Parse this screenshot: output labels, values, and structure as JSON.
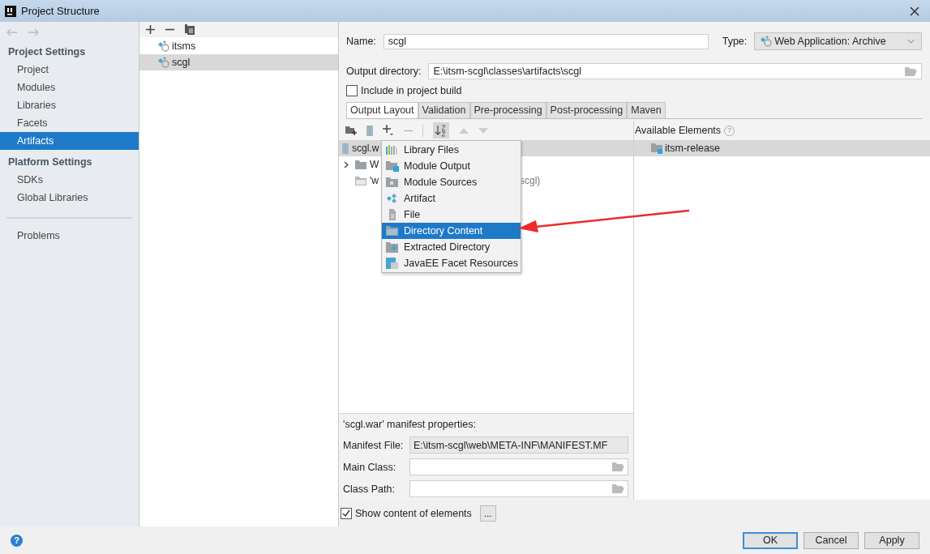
{
  "window": {
    "title": "Project Structure"
  },
  "sidebar": {
    "sections": [
      {
        "heading": "Project Settings",
        "items": [
          {
            "label": "Project",
            "selected": false
          },
          {
            "label": "Modules",
            "selected": false
          },
          {
            "label": "Libraries",
            "selected": false
          },
          {
            "label": "Facets",
            "selected": false
          },
          {
            "label": "Artifacts",
            "selected": true
          }
        ]
      },
      {
        "heading": "Platform Settings",
        "items": [
          {
            "label": "SDKs",
            "selected": false
          },
          {
            "label": "Global Libraries",
            "selected": false
          }
        ]
      }
    ],
    "footer_items": [
      {
        "label": "Problems",
        "selected": false
      }
    ]
  },
  "artifacts": {
    "items": [
      {
        "label": "itsms",
        "selected": false
      },
      {
        "label": "scgl",
        "selected": true
      }
    ]
  },
  "name": {
    "label": "Name:",
    "value": "scgl"
  },
  "type": {
    "label": "Type:",
    "value": "Web Application: Archive"
  },
  "output_directory": {
    "label": "Output directory:",
    "value": "E:\\itsm-scgl\\classes\\artifacts\\scgl"
  },
  "include_in_build": {
    "label": "Include in project build",
    "checked": false
  },
  "tabs": [
    {
      "label": "Output Layout",
      "selected": true
    },
    {
      "label": "Validation",
      "selected": false
    },
    {
      "label": "Pre-processing",
      "selected": false
    },
    {
      "label": "Post-processing",
      "selected": false
    },
    {
      "label": "Maven",
      "selected": false
    }
  ],
  "layout_tree": {
    "rows": [
      {
        "text": "scgl.w",
        "kind": "archive",
        "selected": true
      },
      {
        "text": "W",
        "kind": "folder",
        "selected": false
      },
      {
        "text": "'w",
        "kind": "directory",
        "selected": false,
        "tail": "scgl)"
      }
    ]
  },
  "add_menu": {
    "items": [
      {
        "label": "Library Files",
        "kind": "library",
        "selected": false
      },
      {
        "label": "Module Output",
        "kind": "module-output",
        "selected": false
      },
      {
        "label": "Module Sources",
        "kind": "module-sources",
        "selected": false
      },
      {
        "label": "Artifact",
        "kind": "artifact",
        "selected": false
      },
      {
        "label": "File",
        "kind": "file",
        "selected": false
      },
      {
        "label": "Directory Content",
        "kind": "directory",
        "selected": true
      },
      {
        "label": "Extracted Directory",
        "kind": "extracted",
        "selected": false
      },
      {
        "label": "JavaEE Facet Resources",
        "kind": "facet",
        "selected": false
      }
    ]
  },
  "available_elements": {
    "title": "Available Elements",
    "help": "?",
    "items": [
      {
        "label": "itsm-release",
        "selected": true
      }
    ]
  },
  "manifest": {
    "title": "'scgl.war' manifest properties:",
    "fields": [
      {
        "label": "Manifest File:",
        "value": "E:\\itsm-scgl\\web\\META-INF\\MANIFEST.MF",
        "kind": "readonly"
      },
      {
        "label": "Main Class:",
        "kind": "browse"
      },
      {
        "label": "Class Path:",
        "kind": "browse"
      }
    ]
  },
  "show_content": {
    "label": "Show content of elements",
    "checked": true,
    "button": "..."
  },
  "help": "?",
  "buttons": [
    {
      "label": "OK",
      "default": true
    },
    {
      "label": "Cancel",
      "default": false
    },
    {
      "label": "Apply",
      "default": false
    }
  ]
}
